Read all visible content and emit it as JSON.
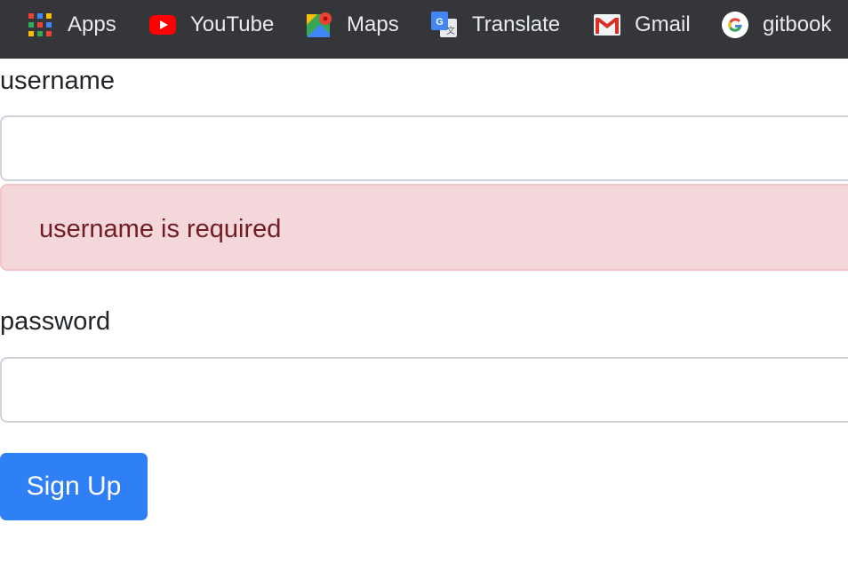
{
  "bookmarks": [
    {
      "label": "Apps",
      "icon": "apps-grid-icon"
    },
    {
      "label": "YouTube",
      "icon": "youtube-icon"
    },
    {
      "label": "Maps",
      "icon": "maps-icon"
    },
    {
      "label": "Translate",
      "icon": "translate-icon"
    },
    {
      "label": "Gmail",
      "icon": "gmail-icon"
    },
    {
      "label": "gitbook",
      "icon": "google-icon"
    }
  ],
  "form": {
    "username_label": "username",
    "username_value": "",
    "username_error": "username is required",
    "password_label": "password",
    "password_value": "",
    "submit_label": "Sign Up"
  },
  "colors": {
    "bookmarks_bar": "#35363a",
    "alert_background": "#f3d7da",
    "alert_text": "#721c24",
    "button": "#2f80f6"
  }
}
